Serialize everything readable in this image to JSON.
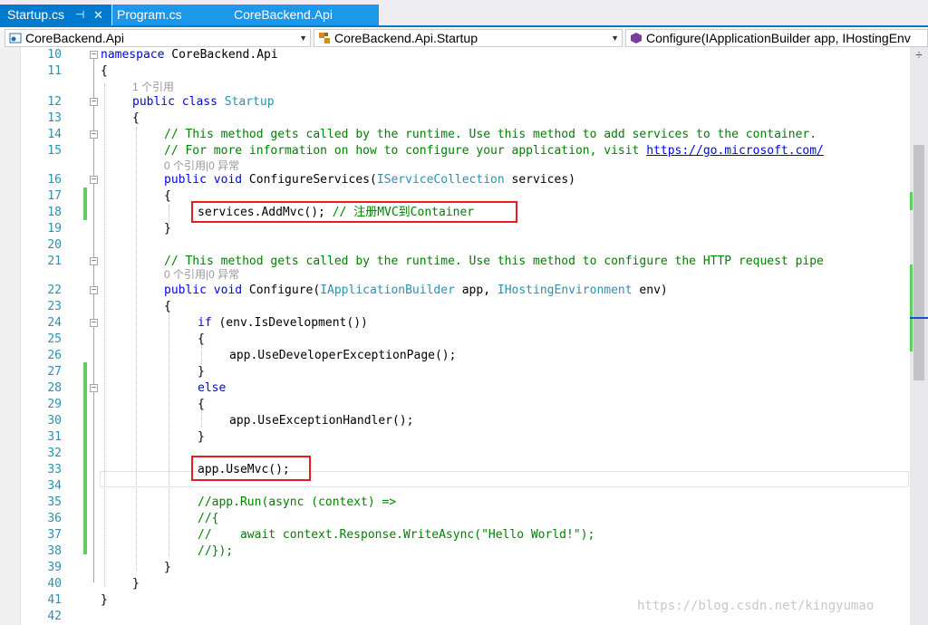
{
  "tabs": [
    {
      "label": "Startup.cs",
      "pin": "⊣",
      "close": "✕"
    },
    {
      "label": "Program.cs"
    },
    {
      "label": "CoreBackend.Api"
    }
  ],
  "nav": {
    "project": "CoreBackend.Api",
    "class": "CoreBackend.Api.Startup",
    "member": "Configure(IApplicationBuilder app, IHostingEnv"
  },
  "lens": {
    "refs1": "1 个引用",
    "refs0": "0 个引用|0 异常"
  },
  "code": {
    "l10_kw": "namespace",
    "l10_rest": " CoreBackend.Api",
    "l11": "{",
    "l12_kw": "public class",
    "l12_ty": "Startup",
    "l13": "{",
    "l14": "// This method gets called by the runtime. Use this method to add services to the container.",
    "l15_a": "// For more information on how to configure your application, visit ",
    "l15_url": "https://go.microsoft.com/",
    "l16_kw": "public void",
    "l16_name": " ConfigureServices(",
    "l16_ty": "IServiceCollection",
    "l16_rest": " services)",
    "l17": "{",
    "l18_code": "services.AddMvc(); ",
    "l18_cm": "// 注册MVC到Container",
    "l19": "}",
    "l21": "// This method gets called by the runtime. Use this method to configure the HTTP request pipe",
    "l22_kw": "public void",
    "l22_name": " Configure(",
    "l22_ty1": "IApplicationBuilder",
    "l22_mid": " app, ",
    "l22_ty2": "IHostingEnvironment",
    "l22_rest": " env)",
    "l23": "{",
    "l24_kw": "if",
    "l24_rest": " (env.IsDevelopment())",
    "l25": "{",
    "l26": "app.UseDeveloperExceptionPage();",
    "l27": "}",
    "l28_kw": "else",
    "l29": "{",
    "l30": "app.UseExceptionHandler();",
    "l31": "}",
    "l33": "app.UseMvc();",
    "l35": "//app.Run(async (context) =>",
    "l36": "//{",
    "l37": "//    await context.Response.WriteAsync(\"Hello World!\");",
    "l38": "//});",
    "l39": "}",
    "l40": "}",
    "l41": "}"
  },
  "line_numbers": [
    "10",
    "11",
    "12",
    "13",
    "14",
    "15",
    "16",
    "17",
    "18",
    "19",
    "20",
    "21",
    "22",
    "23",
    "24",
    "25",
    "26",
    "27",
    "28",
    "29",
    "30",
    "31",
    "32",
    "33",
    "34",
    "35",
    "36",
    "37",
    "38",
    "39",
    "40",
    "41",
    "42"
  ],
  "scrollbar": {
    "split_glyph": "÷"
  },
  "watermark": "https://blog.csdn.net/kingyumao",
  "colors": {
    "accent": "#007acc",
    "keyword": "#0000ff",
    "type": "#2b91af",
    "comment": "#008000",
    "highlight_box": "#e81c1c"
  }
}
